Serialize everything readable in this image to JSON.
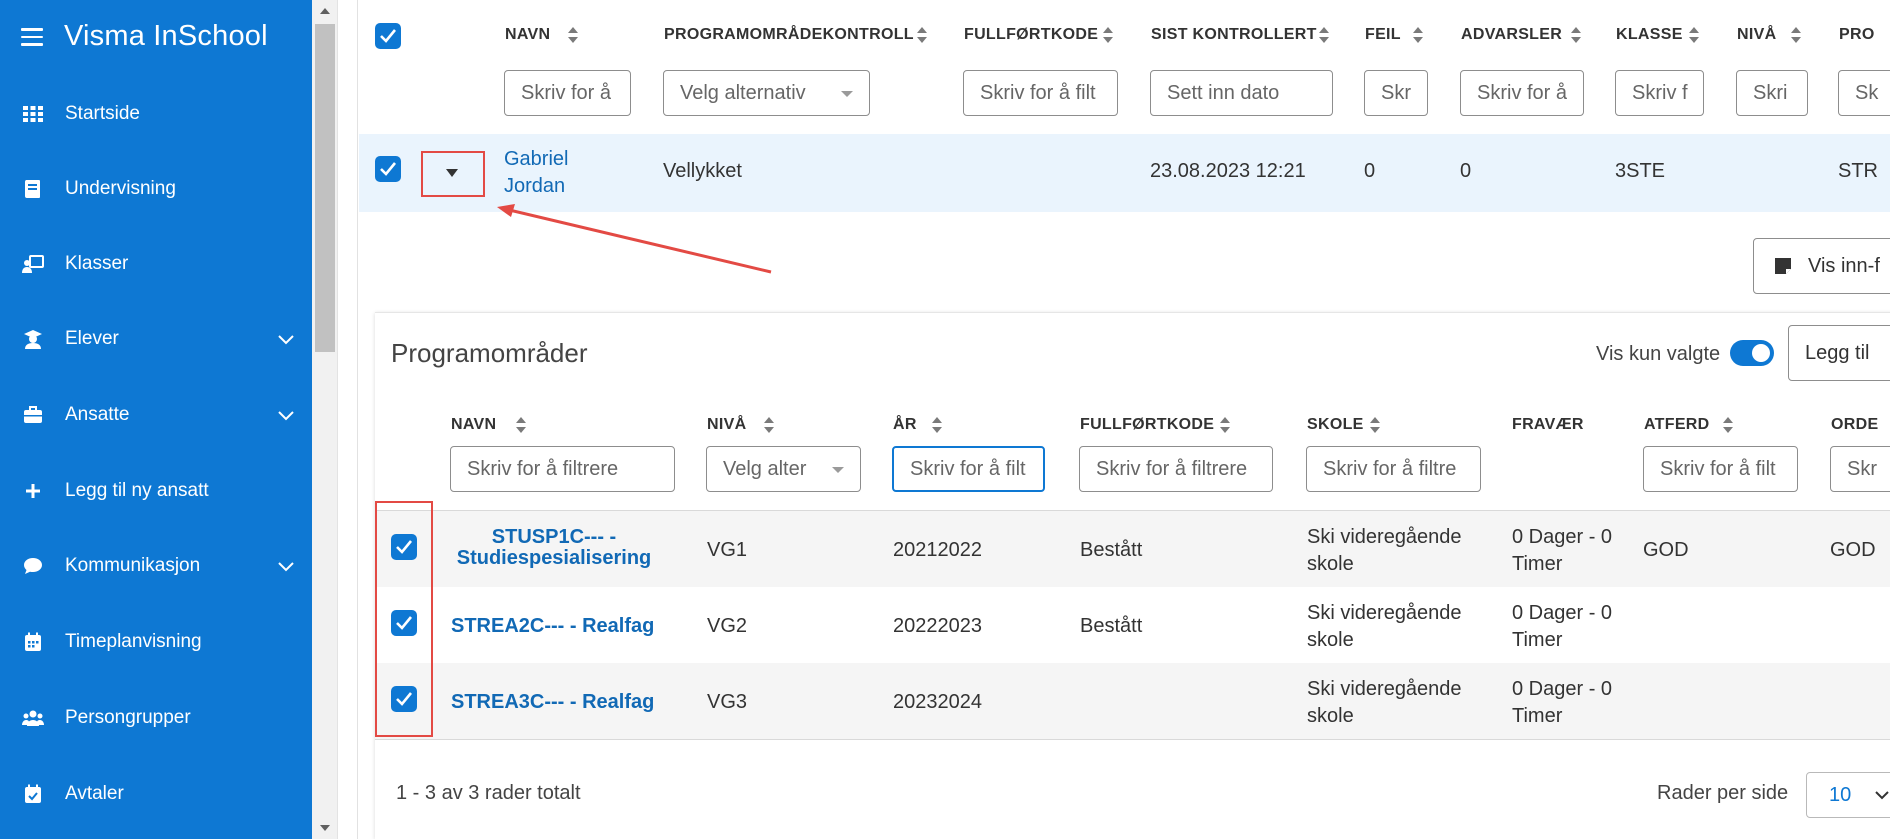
{
  "app": {
    "title": "Visma InSchool"
  },
  "sidebar": {
    "items": [
      {
        "label": "Startside",
        "icon": "grid-icon",
        "expandable": false
      },
      {
        "label": "Undervisning",
        "icon": "book-icon",
        "expandable": false
      },
      {
        "label": "Klasser",
        "icon": "classroom-icon",
        "expandable": false
      },
      {
        "label": "Elever",
        "icon": "graduate-icon",
        "expandable": true
      },
      {
        "label": "Ansatte",
        "icon": "briefcase-icon",
        "expandable": true
      },
      {
        "label": "Legg til ny ansatt",
        "icon": "plus-icon",
        "expandable": false
      },
      {
        "label": "Kommunikasjon",
        "icon": "chat-icon",
        "expandable": true
      },
      {
        "label": "Timeplanvisning",
        "icon": "calendar-icon",
        "expandable": false
      },
      {
        "label": "Persongrupper",
        "icon": "people-icon",
        "expandable": false
      },
      {
        "label": "Avtaler",
        "icon": "calendar-check-icon",
        "expandable": false
      }
    ]
  },
  "table": {
    "headers": {
      "navn": "NAVN",
      "programomradekontroll": "PROGRAMOMRÅDEKONTROLL",
      "fullfortkode": "FULLFØRTKODE",
      "sist_kontrollert": "SIST KONTROLLERT",
      "feil": "FEIL",
      "advarsler": "ADVARSLER",
      "klasse": "KLASSE",
      "niva": "NIVÅ",
      "pro": "PRO"
    },
    "filters": {
      "navn": "Skriv for å",
      "programomradekontroll": "Velg alternativ",
      "fullfortkode": "Skriv for å filt",
      "sist_kontrollert": "Sett inn dato",
      "feil": "Skr",
      "advarsler": "Skriv for å",
      "klasse": "Skriv f",
      "niva": "Skri",
      "pro": "Sk"
    },
    "row": {
      "first_name": "Gabriel",
      "last_name": "Jordan",
      "programomradekontroll": "Vellykket",
      "sist_kontrollert": "23.08.2023 12:21",
      "feil": "0",
      "advarsler": "0",
      "klasse": "3STE",
      "pro": "STR"
    }
  },
  "detail": {
    "vis_button": "Vis inn-f",
    "panel_title": "Programområder",
    "toggle_label": "Vis kun valgte",
    "toggle_on": true,
    "add_button": "Legg til",
    "headers": {
      "navn": "NAVN",
      "niva": "NIVÅ",
      "ar": "ÅR",
      "fullfortkode": "FULLFØRTKODE",
      "skole": "SKOLE",
      "fravaer": "FRAVÆR",
      "atferd": "ATFERD",
      "orden": "ORDE"
    },
    "filters": {
      "navn": "Skriv for å filtrere",
      "niva": "Velg alter",
      "ar": "Skriv for å filt",
      "fullfortkode": "Skriv for å filtrere",
      "skole": "Skriv for å filtre",
      "atferd": "Skriv for å filt",
      "orden": "Skr"
    },
    "rows": [
      {
        "navn_line1": "STUSP1C--- -",
        "navn_line2": "Studiespesialisering",
        "niva": "VG1",
        "ar": "20212022",
        "fullfortkode": "Bestått",
        "skole_line1": "Ski videregående",
        "skole_line2": "skole",
        "fravaer_line1": "0 Dager - 0",
        "fravaer_line2": "Timer",
        "atferd": "GOD",
        "orden": "GOD"
      },
      {
        "navn_line1": "STREA2C--- - Realfag",
        "navn_line2": "",
        "niva": "VG2",
        "ar": "20222023",
        "fullfortkode": "Bestått",
        "skole_line1": "Ski videregående",
        "skole_line2": "skole",
        "fravaer_line1": "0 Dager - 0",
        "fravaer_line2": "Timer",
        "atferd": "",
        "orden": ""
      },
      {
        "navn_line1": "STREA3C--- - Realfag",
        "navn_line2": "",
        "niva": "VG3",
        "ar": "20232024",
        "fullfortkode": "",
        "skole_line1": "Ski videregående",
        "skole_line2": "skole",
        "fravaer_line1": "0 Dager - 0",
        "fravaer_line2": "Timer",
        "atferd": "",
        "orden": ""
      }
    ],
    "pagination": {
      "summary": "1 - 3 av 3 rader totalt",
      "rows_per_page_label": "Rader per side",
      "rows_per_page": "10"
    }
  },
  "colors": {
    "brand": "#0e78d3",
    "link": "#1169b5",
    "annotation": "#e34a44"
  }
}
